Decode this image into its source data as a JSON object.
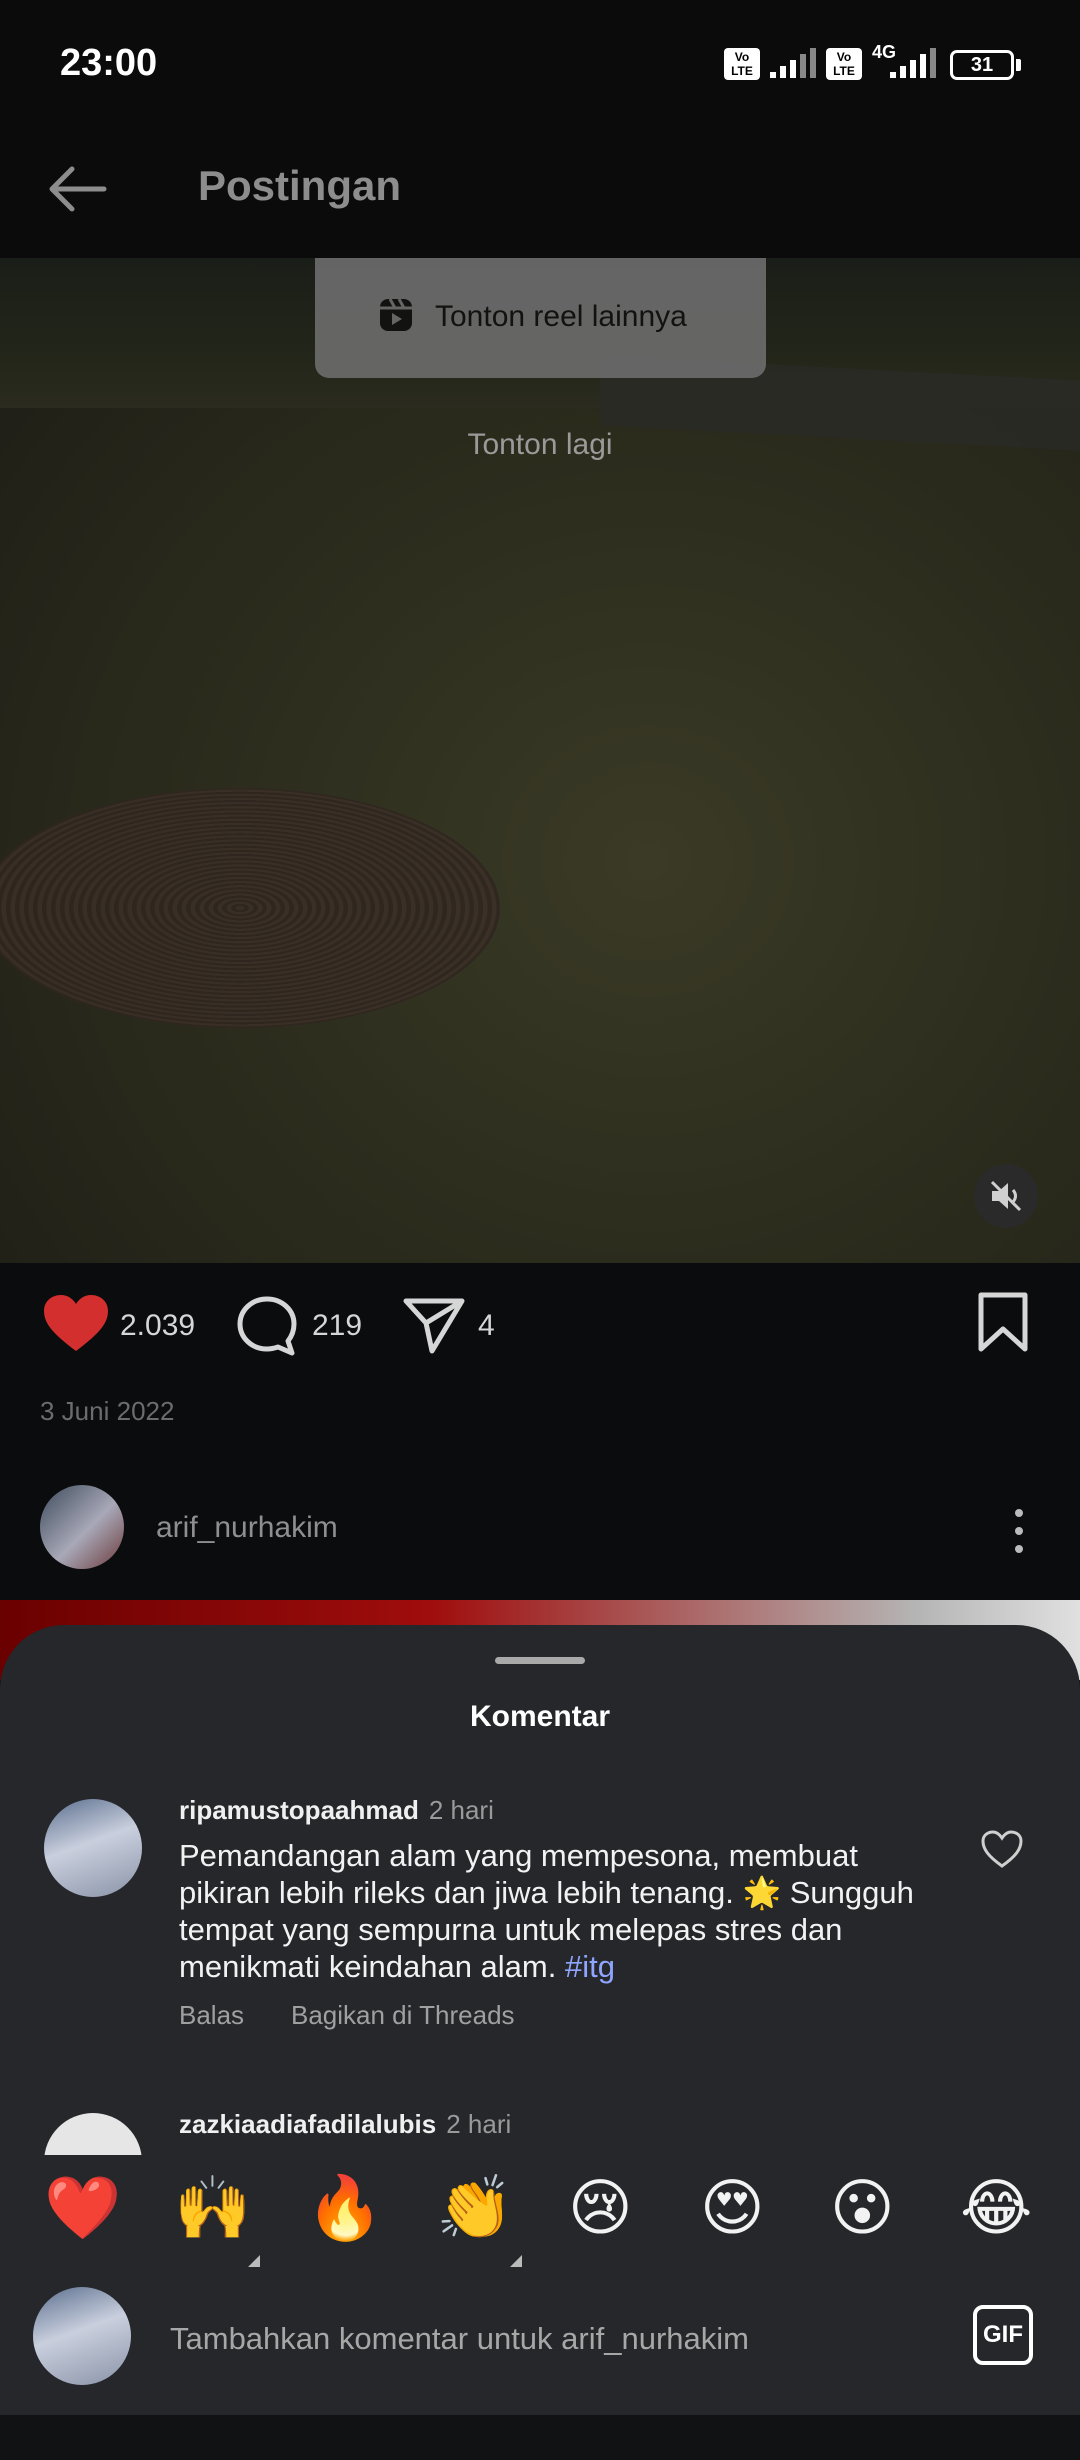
{
  "status_bar": {
    "time": "23:00",
    "battery": "31",
    "network": "4G"
  },
  "app_bar": {
    "title": "Postingan"
  },
  "video": {
    "reel_button_label": "Tonton reel lainnya",
    "replay_label": "Tonton lagi"
  },
  "post": {
    "likes": "2.039",
    "comments": "219",
    "shares": "4",
    "date": "3 Juni 2022",
    "author": "arif_nurhakim"
  },
  "comments_sheet": {
    "title": "Komentar",
    "comments": [
      {
        "user": "ripamustopaahmad",
        "time": "2 hari",
        "text": "Pemandangan alam yang mempesona, membuat pikiran lebih rileks dan jiwa lebih tenang. 🌟 Sungguh tempat yang sempurna untuk melepas stres dan menikmati keindahan alam.",
        "hashtag": "#itg",
        "reply": "Balas",
        "share_threads": "Bagikan di Threads"
      },
      {
        "user": "zazkiaadiafadilalubis",
        "time": "2 hari"
      }
    ]
  },
  "emoji_bar": [
    "❤️",
    "🙌",
    "🔥",
    "👏",
    "😢",
    "😍",
    "😮",
    "😂"
  ],
  "comment_input": {
    "placeholder": "Tambahkan komentar untuk arif_nurhakim",
    "gif_label": "GIF"
  },
  "colors": {
    "heart": "#d32f2f",
    "hashtag": "#8fa5ff",
    "sheet_bg": "#25272b"
  }
}
